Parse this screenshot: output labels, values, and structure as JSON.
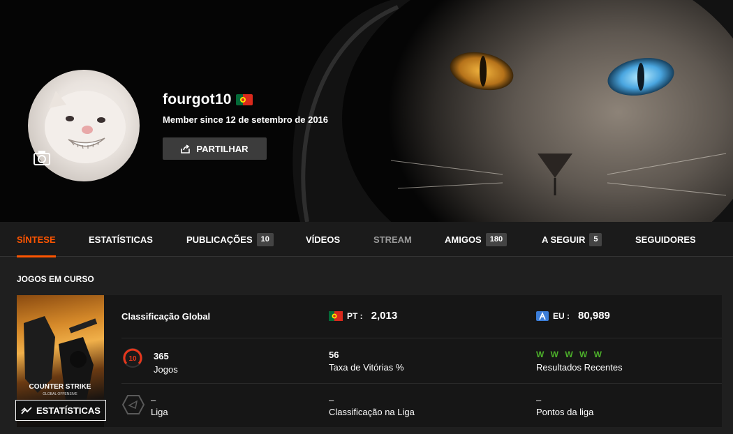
{
  "profile": {
    "username": "fourgot10",
    "member_since": "Member since 12 de setembro de 2016",
    "share_label": "PARTILHAR",
    "country_flag_icon": "portugal-flag-icon",
    "camera_icon": "camera-icon",
    "share_icon": "share-icon"
  },
  "tabs": [
    {
      "label": "SÍNTESE",
      "badge": null,
      "state": "active"
    },
    {
      "label": "ESTATÍSTICAS",
      "badge": null,
      "state": "normal"
    },
    {
      "label": "PUBLICAÇÕES",
      "badge": "10",
      "state": "normal"
    },
    {
      "label": "VÍDEOS",
      "badge": null,
      "state": "normal"
    },
    {
      "label": "STREAM",
      "badge": null,
      "state": "disabled"
    },
    {
      "label": "AMIGOS",
      "badge": "180",
      "state": "normal"
    },
    {
      "label": "A SEGUIR",
      "badge": "5",
      "state": "normal"
    },
    {
      "label": "SEGUIDORES",
      "badge": null,
      "state": "normal"
    }
  ],
  "section": {
    "title": "JOGOS EM CURSO"
  },
  "game": {
    "cover_title": "COUNTER STRIKE",
    "cover_subtitle": "GLOBAL OFFENSIVE",
    "stats_button_label": "ESTATÍSTICAS",
    "stats_icon": "trend-chart-icon",
    "global_rank_label": "Classificação Global",
    "country_rank": {
      "prefix": "PT :",
      "value": "2,013",
      "icon": "portugal-flag-icon"
    },
    "region_rank": {
      "prefix": "EU :",
      "value": "80,989",
      "icon": "europe-region-icon"
    },
    "level": "10",
    "level_icon": "skill-level-gauge-icon",
    "games": {
      "value": "365",
      "label": "Jogos"
    },
    "win_rate": {
      "value": "56",
      "label": "Taxa de Vitórias %"
    },
    "recent_results": {
      "value": "W W W W W",
      "label": "Resultados Recentes"
    },
    "league": {
      "value": "–",
      "label": "Liga",
      "icon": "league-hexagon-icon"
    },
    "league_rank": {
      "value": "–",
      "label": "Classificação na Liga"
    },
    "league_points": {
      "value": "–",
      "label": "Pontos da liga"
    }
  },
  "colors": {
    "accent": "#ff5500",
    "win": "#4caf2a",
    "badge_bg": "#444444",
    "panel_bg": "#161616"
  }
}
